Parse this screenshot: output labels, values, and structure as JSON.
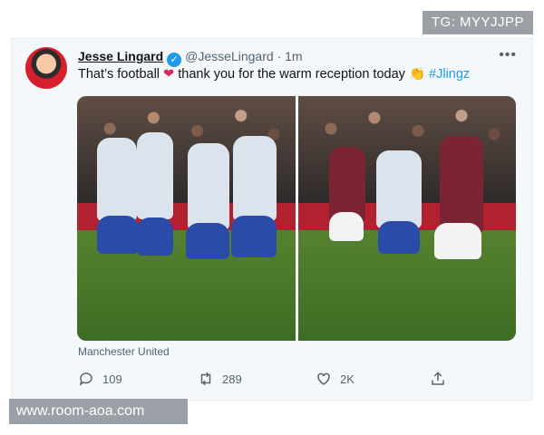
{
  "watermark_top": "TG: MYYJJPP",
  "watermark_bottom": "www.room-aoa.com",
  "tweet": {
    "author_name": "Jesse Lingard",
    "handle": "@JesseLingard",
    "separator": "·",
    "time": "1m",
    "text_part1": "That’s football",
    "text_part2": "thank you for the warm reception today",
    "hashtag": "#Jlingz",
    "media_caption": "Manchester United",
    "stats": {
      "replies": "109",
      "retweets": "289",
      "likes": "2K"
    },
    "icons": {
      "verified": "verified-badge-icon",
      "heart_emoji": "red-heart-emoji",
      "clap_emoji": "clapping-hands-emoji",
      "more": "more-options-icon",
      "reply": "reply-icon",
      "retweet": "retweet-icon",
      "like": "like-icon",
      "share": "share-icon"
    },
    "colors": {
      "accent": "#1d9bf0",
      "heart": "#e0245e",
      "muted": "#536471"
    }
  }
}
